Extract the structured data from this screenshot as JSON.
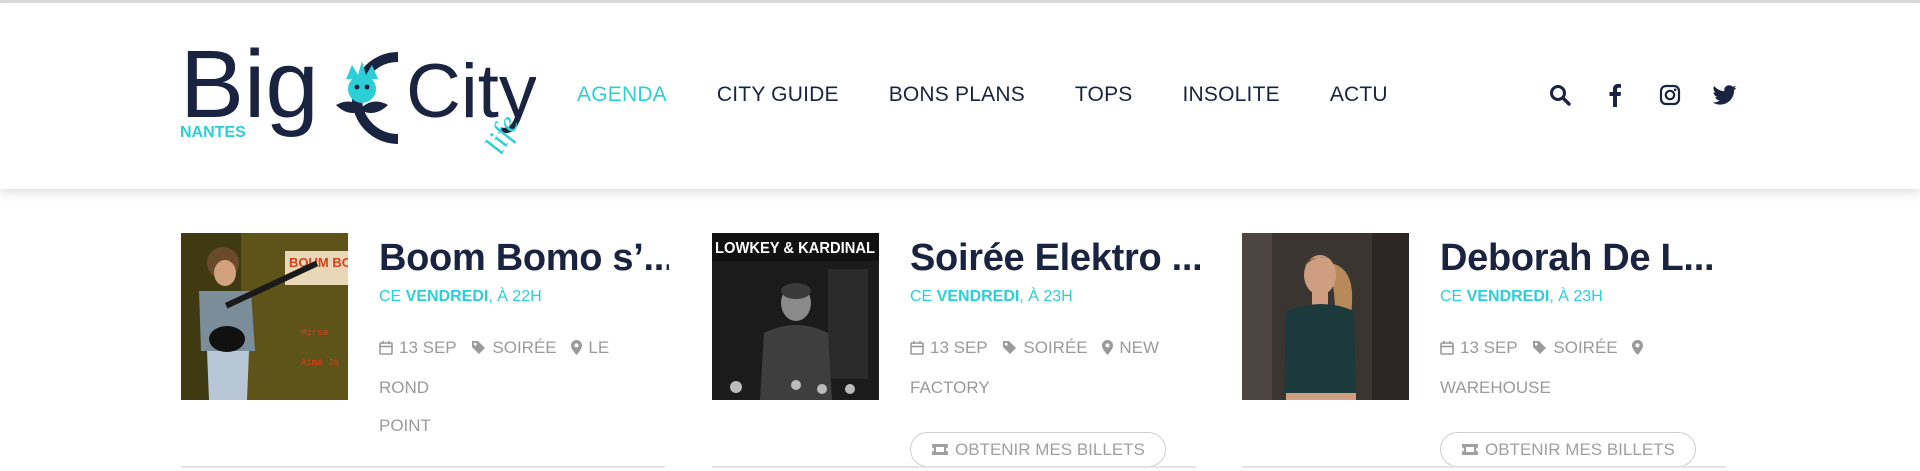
{
  "brand": {
    "logo_text_big": "Big",
    "logo_text_city": "City",
    "logo_text_life": "life",
    "logo_city_name": "NANTES",
    "color_dark": "#1a2340",
    "color_accent": "#2ccfd6"
  },
  "nav": {
    "items": [
      {
        "label": "AGENDA",
        "active": true
      },
      {
        "label": "CITY GUIDE",
        "active": false
      },
      {
        "label": "BONS PLANS",
        "active": false
      },
      {
        "label": "TOPS",
        "active": false
      },
      {
        "label": "INSOLITE",
        "active": false
      },
      {
        "label": "ACTU",
        "active": false
      }
    ]
  },
  "header_icons": [
    "search-icon",
    "facebook-icon",
    "instagram-icon",
    "twitter-icon"
  ],
  "events": [
    {
      "title": "Boom Bomo s’...",
      "when_prefix": "CE ",
      "when_day": "VENDREDI",
      "when_time": ", À 22H",
      "date": "13 SEP",
      "category": "SOIRÉE",
      "venue_line1": "LE ROND",
      "venue_line2": "POINT",
      "has_tickets": false,
      "tickets_label": ""
    },
    {
      "title": "Soirée Elektro ...",
      "when_prefix": "CE ",
      "when_day": "VENDREDI",
      "when_time": ", À 23H",
      "date": "13 SEP",
      "category": "SOIRÉE",
      "venue_line1": "NEW",
      "venue_line2": "FACTORY",
      "has_tickets": true,
      "tickets_label": "OBTENIR MES BILLETS",
      "image_caption": "LOWKEY & KARDINAL"
    },
    {
      "title": "Deborah De L...",
      "when_prefix": "CE ",
      "when_day": "VENDREDI",
      "when_time": ", À 23H",
      "date": "13 SEP",
      "category": "SOIRÉE",
      "venue_line1": "",
      "venue_line2": "WAREHOUSE",
      "has_tickets": true,
      "tickets_label": "OBTENIR MES BILLETS"
    }
  ],
  "poster_text": {
    "boom": "BOUM BO",
    "name1": "Mirsa",
    "name2": "Aimé Jo"
  }
}
